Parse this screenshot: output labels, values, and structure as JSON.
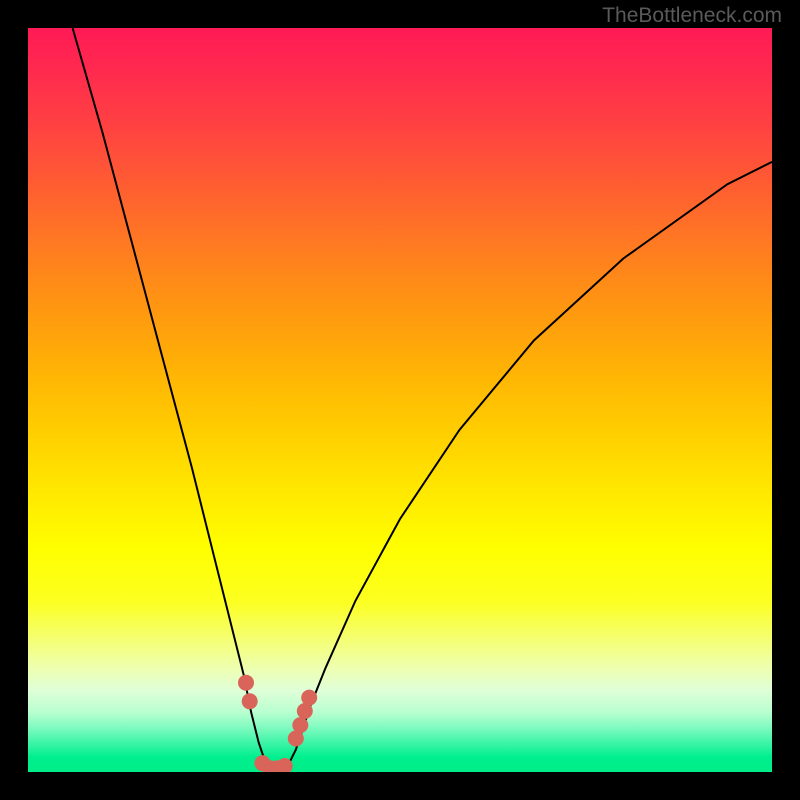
{
  "watermark": "TheBottleneck.com",
  "chart_data": {
    "type": "line",
    "title": "",
    "xlabel": "",
    "ylabel": "",
    "xlim": [
      0,
      100
    ],
    "ylim": [
      0,
      100
    ],
    "grid": false,
    "legend": false,
    "description": "Bottleneck curve chart. Y axis (implicit) is bottleneck severity from 0 (green, bottom) to 100 (red, top). X axis (implicit) is a hardware balance ratio. The black curve is a V-shape dipping to ~0 near x≈33 marking the balanced point.",
    "series": [
      {
        "name": "bottleneck-curve",
        "x": [
          6,
          10,
          14,
          18,
          22,
          25,
          27,
          29,
          30,
          31,
          32,
          33,
          34,
          35,
          36,
          37,
          38,
          40,
          44,
          50,
          58,
          68,
          80,
          94,
          100
        ],
        "y": [
          100,
          86,
          71,
          56,
          41,
          29,
          21,
          13,
          8,
          4,
          1,
          0,
          0,
          1,
          3,
          6,
          9,
          14,
          23,
          34,
          46,
          58,
          69,
          79,
          82
        ]
      }
    ],
    "markers": {
      "name": "highlight-points",
      "color": "#d9655a",
      "x": [
        29.3,
        29.8,
        31.5,
        32.5,
        33.5,
        34.5,
        36.0,
        36.6,
        37.2,
        37.8
      ],
      "y": [
        12.0,
        9.5,
        1.2,
        0.5,
        0.5,
        0.8,
        4.5,
        6.3,
        8.2,
        10.0
      ]
    },
    "background_gradient": {
      "top": "#ff1a55",
      "mid": "#ffe700",
      "bottom": "#00ed88"
    }
  }
}
